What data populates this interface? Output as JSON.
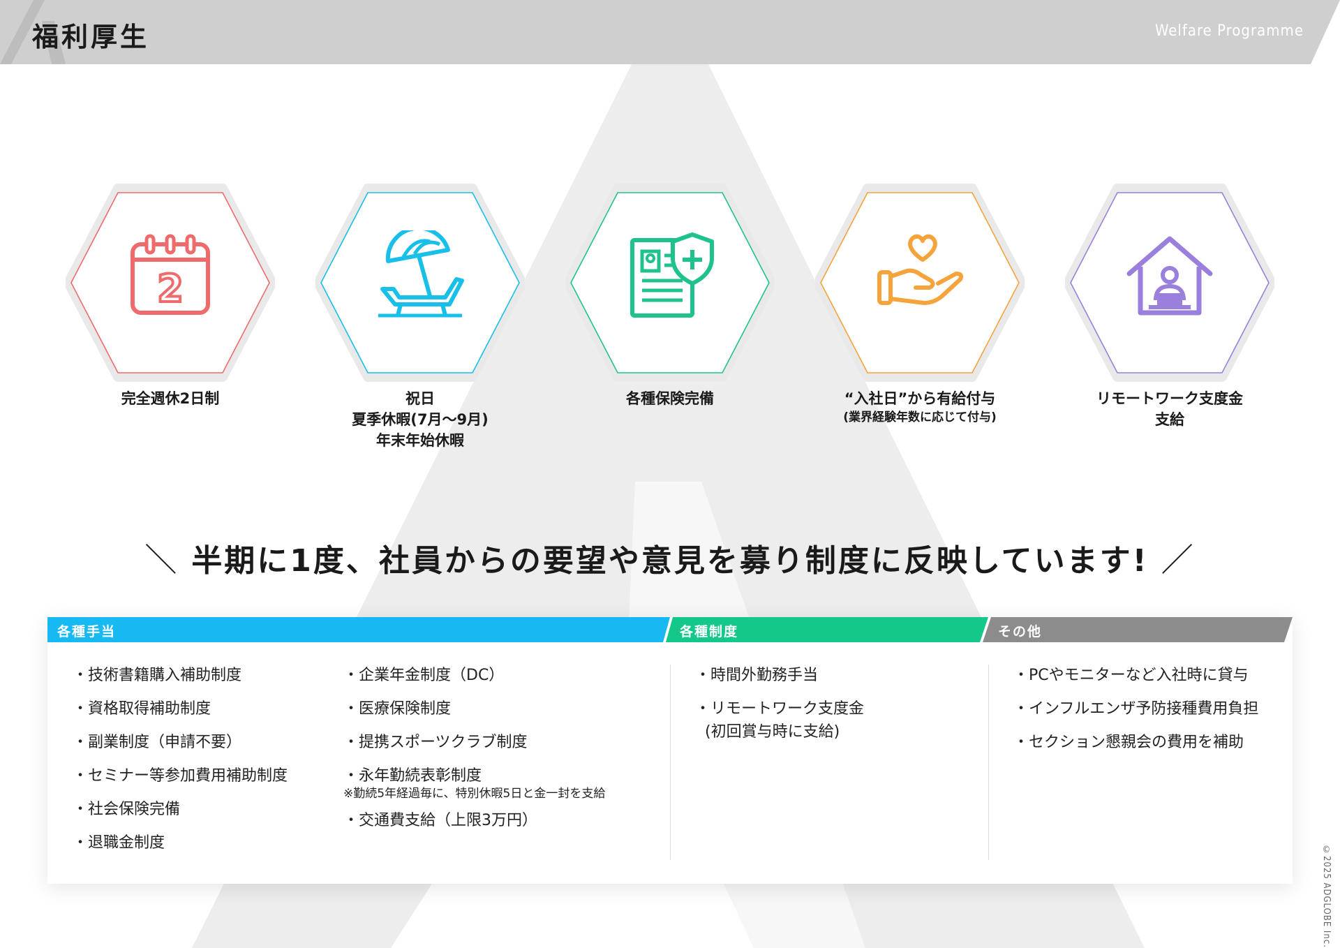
{
  "header": {
    "title": "福利厚生",
    "subtitle": "Welfare Programme"
  },
  "features": [
    {
      "icon": "calendar-icon",
      "color": "#ef6a6a",
      "lines": [
        "完全週休2日制"
      ]
    },
    {
      "icon": "beach-chair-icon",
      "color": "#18bfe8",
      "lines": [
        "祝日",
        "夏季休暇(7月〜9月)",
        "年末年始休暇"
      ]
    },
    {
      "icon": "insurance-document-icon",
      "color": "#1fc28f",
      "lines": [
        "各種保険完備"
      ]
    },
    {
      "icon": "heart-hand-icon",
      "color": "#f5a33b",
      "lines": [
        "“入社日”から有給付与"
      ],
      "note": "(業界経験年数に応じて付与)"
    },
    {
      "icon": "home-work-icon",
      "color": "#9a7fdc",
      "lines": [
        "リモートワーク支度金",
        "支給"
      ]
    }
  ],
  "calendar_number": "2",
  "slogan": "半期に1度、社員からの要望や意見を募り制度に反映しています!",
  "categories": [
    {
      "label": "各種手当",
      "color": "#16b9f2"
    },
    {
      "label": "各種制度",
      "color": "#14c88a"
    },
    {
      "label": "その他",
      "color": "#8c8c8c"
    }
  ],
  "allowances_col1": [
    "・技術書籍購入補助制度",
    "・資格取得補助制度",
    "・副業制度（申請不要）",
    "・セミナー等参加費用補助制度",
    "・社会保険完備",
    "・退職金制度"
  ],
  "allowances_col2": [
    "・企業年金制度（DC）",
    "・医療保険制度",
    "・提携スポーツクラブ制度",
    "・永年勤続表彰制度"
  ],
  "allowances_col2_note": "※勤続5年経過毎に、特別休暇5日と金一封を支給",
  "allowances_col2_last": "・交通費支給（上限3万円）",
  "systems": [
    "・時間外勤務手当",
    "・リモートワーク支度金"
  ],
  "systems_cont": "(初回賞与時に支給)",
  "others": [
    "・PCやモニターなど入社時に貸与",
    "・インフルエンザ予防接種費用負担",
    "・セクション懇親会の費用を補助"
  ],
  "copyright": "©2025 ADGLOBE Inc."
}
